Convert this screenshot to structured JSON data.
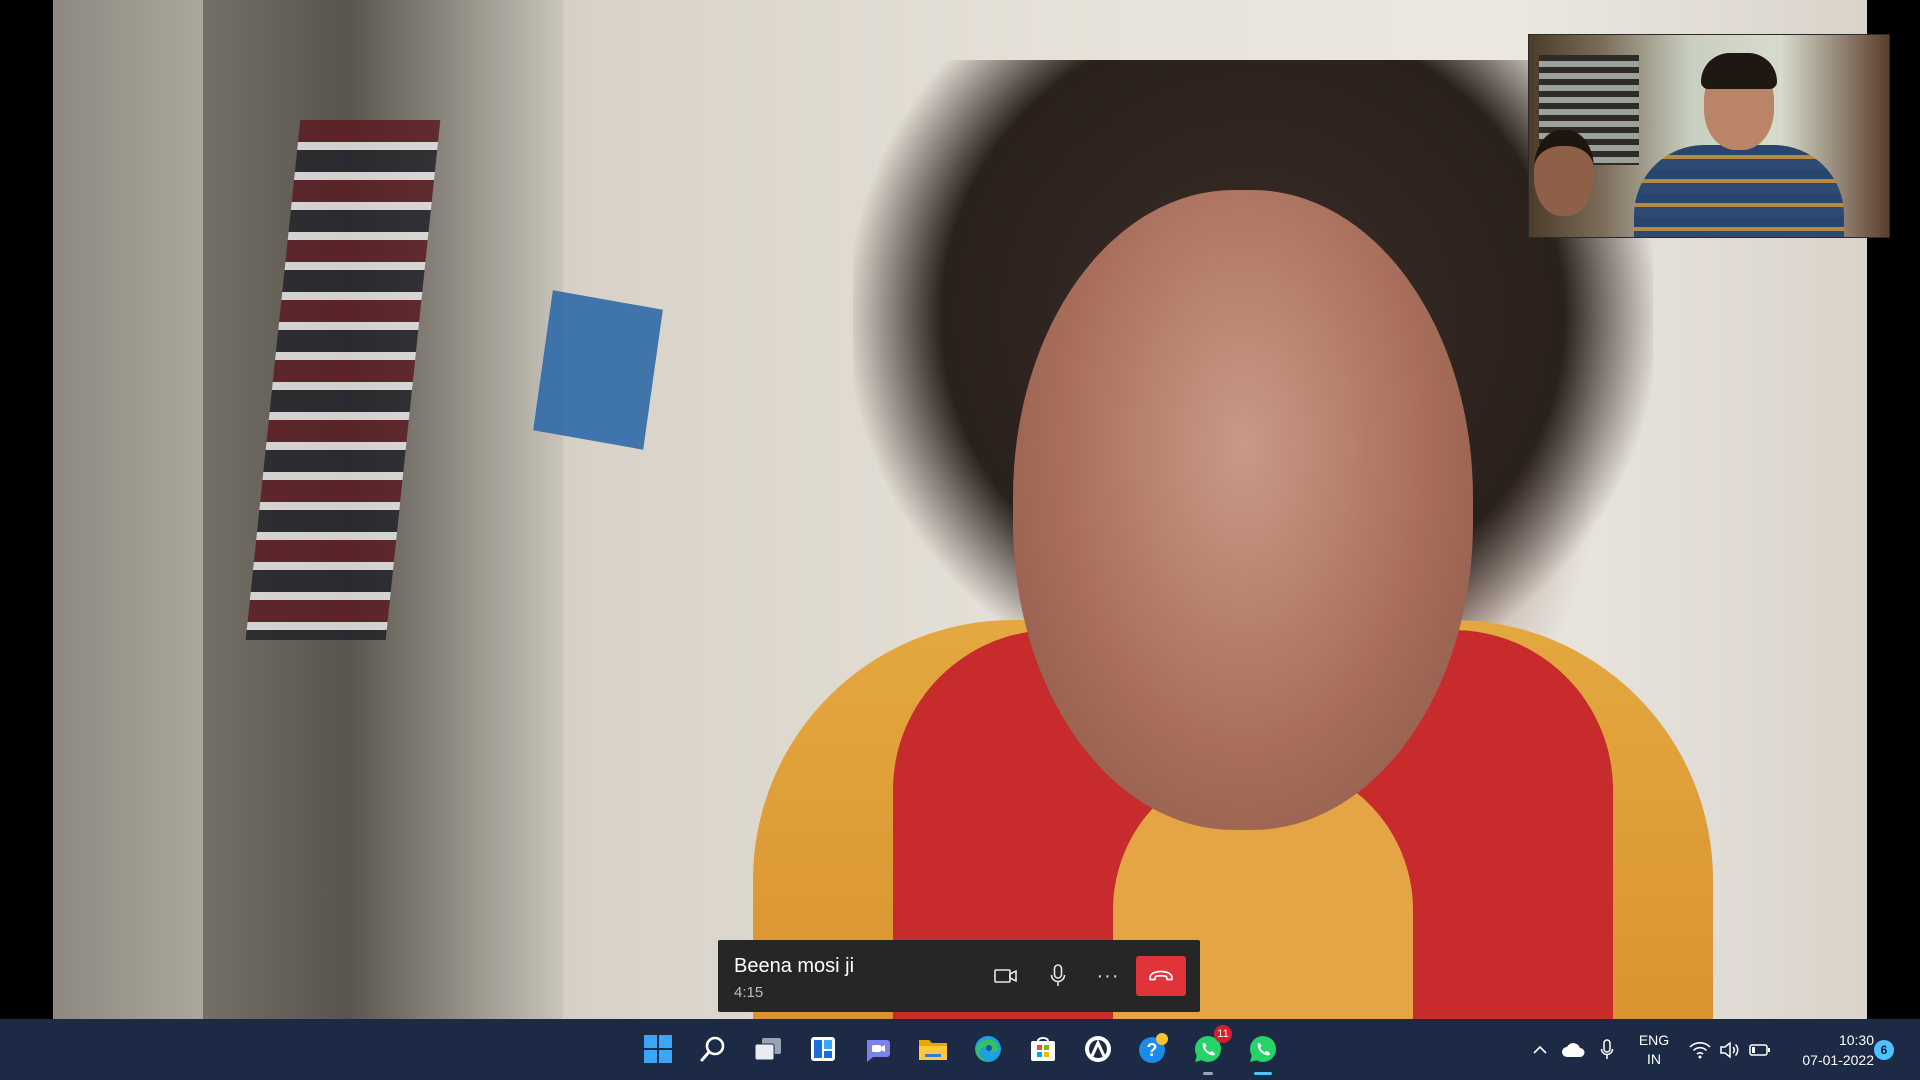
{
  "call": {
    "caller_name": "Beena mosi ji",
    "duration": "4:15",
    "controls": {
      "video_icon": "video-camera-icon",
      "mic_icon": "microphone-icon",
      "more": "···",
      "end_icon": "end-call-icon"
    },
    "end_color": "#e0343a"
  },
  "taskbar": {
    "apps": [
      {
        "name": "start",
        "icon": "windows-start-icon"
      },
      {
        "name": "search",
        "icon": "search-icon"
      },
      {
        "name": "task-view",
        "icon": "task-view-icon"
      },
      {
        "name": "widgets",
        "icon": "widgets-icon"
      },
      {
        "name": "chat",
        "icon": "teams-chat-icon"
      },
      {
        "name": "file-explorer",
        "icon": "folder-icon"
      },
      {
        "name": "edge",
        "icon": "edge-browser-icon"
      },
      {
        "name": "store",
        "icon": "microsoft-store-icon"
      },
      {
        "name": "app",
        "icon": "circle-app-icon"
      },
      {
        "name": "help",
        "icon": "get-help-icon"
      },
      {
        "name": "whatsapp",
        "icon": "whatsapp-icon",
        "badge": "11"
      },
      {
        "name": "whatsapp-active",
        "icon": "whatsapp-icon"
      }
    ],
    "tray": {
      "language_line1": "ENG",
      "language_line2": "IN",
      "time": "10:30",
      "date": "07-01-2022",
      "notifications": "6"
    },
    "background": "#1c2a46"
  }
}
